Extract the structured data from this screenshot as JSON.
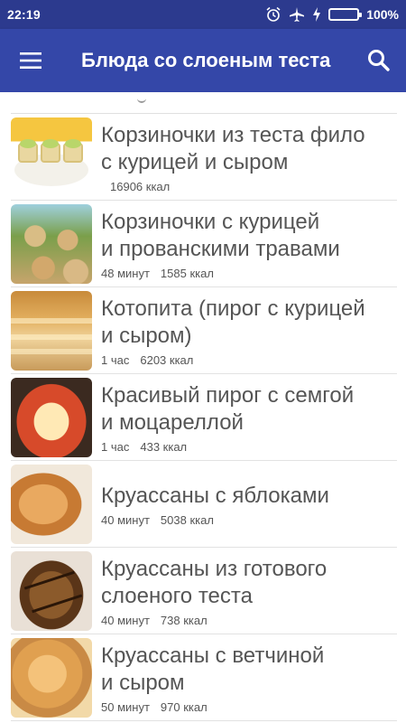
{
  "status_bar": {
    "time": "22:19",
    "battery_percent": "100%",
    "battery_level": 1.0,
    "icons": [
      "alarm-icon",
      "airplane-mode-icon",
      "charging-icon",
      "battery-icon"
    ]
  },
  "app_bar": {
    "title": "Блюда со слоеным теста",
    "menu_icon": "hamburger-menu-icon",
    "search_icon": "search-icon"
  },
  "colors": {
    "status_bar": "#2c3a8e",
    "app_bar": "#3447a8",
    "text": "#555555",
    "battery": "#6fe36a"
  },
  "recipes": [
    {
      "title_line1": "Корзиночки из теста фило",
      "title_line2": "с курицей и сыром",
      "time": "",
      "kcal": "16906 ккал"
    },
    {
      "title_line1": "Корзиночки с курицей",
      "title_line2": "и прованскими травами",
      "time": "48 минут",
      "kcal": "1585 ккал"
    },
    {
      "title_line1": "Котопита (пирог с курицей",
      "title_line2": "и сыром)",
      "time": "1 час",
      "kcal": "6203 ккал"
    },
    {
      "title_line1": "Красивый пирог с семгой",
      "title_line2": "и моцареллой",
      "time": "1 час",
      "kcal": "433 ккал"
    },
    {
      "title_line1": "Круассаны с яблоками",
      "title_line2": "",
      "time": "40 минут",
      "kcal": "5038 ккал"
    },
    {
      "title_line1": "Круассаны из готового",
      "title_line2": "слоеного теста",
      "time": "40 минут",
      "kcal": "738 ккал"
    },
    {
      "title_line1": "Круассаны с ветчиной",
      "title_line2": "и сыром",
      "time": "50 минут",
      "kcal": "970 ккал"
    }
  ]
}
